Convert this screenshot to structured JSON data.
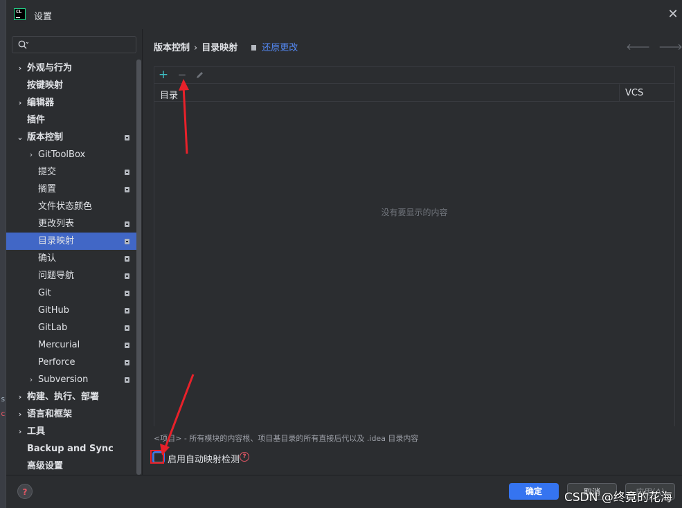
{
  "window": {
    "title": "设置",
    "app_logo": "CL"
  },
  "sidebar": {
    "search_placeholder": "",
    "items": [
      {
        "label": "外观与行为",
        "expandable": true,
        "bold": true,
        "locked": false
      },
      {
        "label": "按键映射",
        "expandable": false,
        "bold": true,
        "locked": false
      },
      {
        "label": "编辑器",
        "expandable": true,
        "bold": true,
        "locked": false
      },
      {
        "label": "插件",
        "expandable": false,
        "bold": true,
        "locked": false
      },
      {
        "label": "版本控制",
        "expandable": true,
        "expanded": true,
        "bold": true,
        "locked": true
      },
      {
        "label": "GitToolBox",
        "expandable": true,
        "bold": false,
        "locked": false
      },
      {
        "label": "提交",
        "expandable": false,
        "bold": false,
        "locked": true
      },
      {
        "label": "搁置",
        "expandable": false,
        "bold": false,
        "locked": true
      },
      {
        "label": "文件状态颜色",
        "expandable": false,
        "bold": false,
        "locked": false
      },
      {
        "label": "更改列表",
        "expandable": false,
        "bold": false,
        "locked": true
      },
      {
        "label": "目录映射",
        "expandable": false,
        "bold": false,
        "locked": true,
        "selected": true
      },
      {
        "label": "确认",
        "expandable": false,
        "bold": false,
        "locked": true
      },
      {
        "label": "问题导航",
        "expandable": false,
        "bold": false,
        "locked": true
      },
      {
        "label": "Git",
        "expandable": false,
        "bold": false,
        "locked": true
      },
      {
        "label": "GitHub",
        "expandable": false,
        "bold": false,
        "locked": true
      },
      {
        "label": "GitLab",
        "expandable": false,
        "bold": false,
        "locked": true
      },
      {
        "label": "Mercurial",
        "expandable": false,
        "bold": false,
        "locked": true
      },
      {
        "label": "Perforce",
        "expandable": false,
        "bold": false,
        "locked": true
      },
      {
        "label": "Subversion",
        "expandable": true,
        "bold": false,
        "locked": true
      },
      {
        "label": "构建、执行、部署",
        "expandable": true,
        "bold": true,
        "locked": false
      },
      {
        "label": "语言和框架",
        "expandable": true,
        "bold": true,
        "locked": false
      },
      {
        "label": "工具",
        "expandable": true,
        "bold": true,
        "locked": false
      },
      {
        "label": "Backup and Sync",
        "expandable": false,
        "bold": true,
        "locked": false
      },
      {
        "label": "高级设置",
        "expandable": false,
        "bold": true,
        "locked": false
      }
    ]
  },
  "breadcrumb": {
    "parent": "版本控制",
    "current": "目录映射",
    "reset_link": "还原更改"
  },
  "table": {
    "columns": [
      "目录",
      "VCS"
    ],
    "empty_text": "没有要显示的内容"
  },
  "footnote": "<项目> - 所有模块的内容根、项目基目录的所有直接后代以及 .idea 目录内容",
  "auto_detect": {
    "label": "启用自动映射检测",
    "checked": false
  },
  "footer": {
    "ok": "确定",
    "cancel": "取消",
    "apply": "应用(A)"
  },
  "watermark": "CSDN @终竟的花海",
  "background_leak": [
    "s",
    "c"
  ],
  "colors": {
    "accent": "#3574f0",
    "link": "#548af7",
    "selection": "#4167c6",
    "annotation": "#e8212a"
  }
}
